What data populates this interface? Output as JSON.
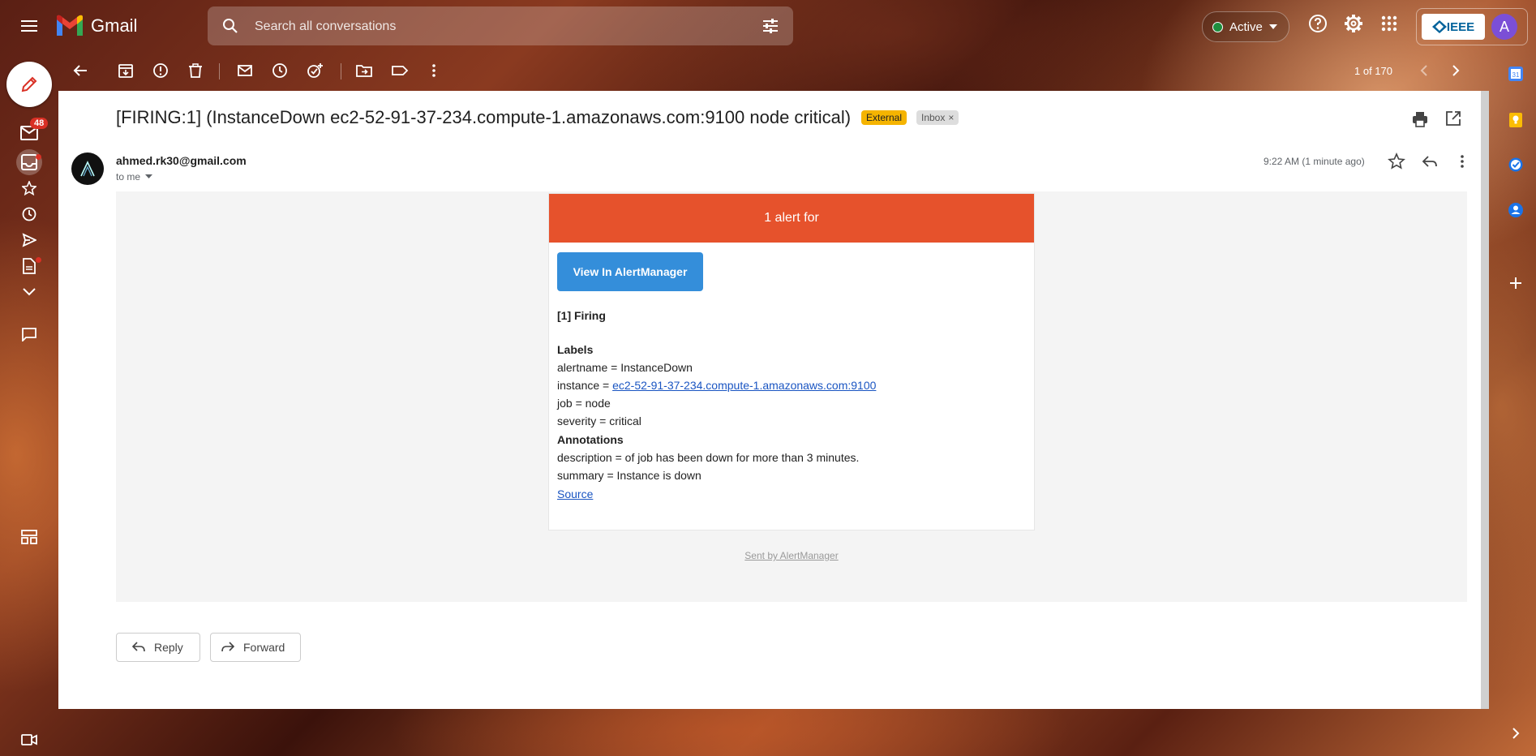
{
  "app": {
    "name": "Gmail"
  },
  "search": {
    "placeholder": "Search all conversations"
  },
  "status": {
    "label": "Active",
    "color": "#1e8e3e"
  },
  "account": {
    "org_logo_text": "IEEE",
    "avatar_initial": "A"
  },
  "nav": {
    "inbox_badge": "48"
  },
  "toolbar": {
    "pager": "1 of 170"
  },
  "email": {
    "subject": "[FIRING:1] (InstanceDown ec2-52-91-37-234.compute-1.amazonaws.com:9100 node critical)",
    "labels": [
      "External",
      "Inbox"
    ],
    "sender": "ahmed.rk30@gmail.com",
    "recipient_label": "to me",
    "time": "9:22 AM (1 minute ago)"
  },
  "alert": {
    "header": "1 alert for",
    "header_color": "#e6522c",
    "button_label": "View In AlertManager",
    "firing_title": "[1] Firing",
    "labels_title": "Labels",
    "alertname_line": "alertname = InstanceDown",
    "instance_prefix": "instance = ",
    "instance_link": "ec2-52-91-37-234.compute-1.amazonaws.com:9100",
    "job_line": "job = node",
    "severity_line": "severity = critical",
    "annotations_title": "Annotations",
    "description_line": "description = of job has been down for more than 3 minutes.",
    "summary_line": "summary = Instance is down",
    "source_link": "Source",
    "sent_by": "Sent by AlertManager"
  },
  "actions": {
    "reply": "Reply",
    "forward": "Forward"
  }
}
